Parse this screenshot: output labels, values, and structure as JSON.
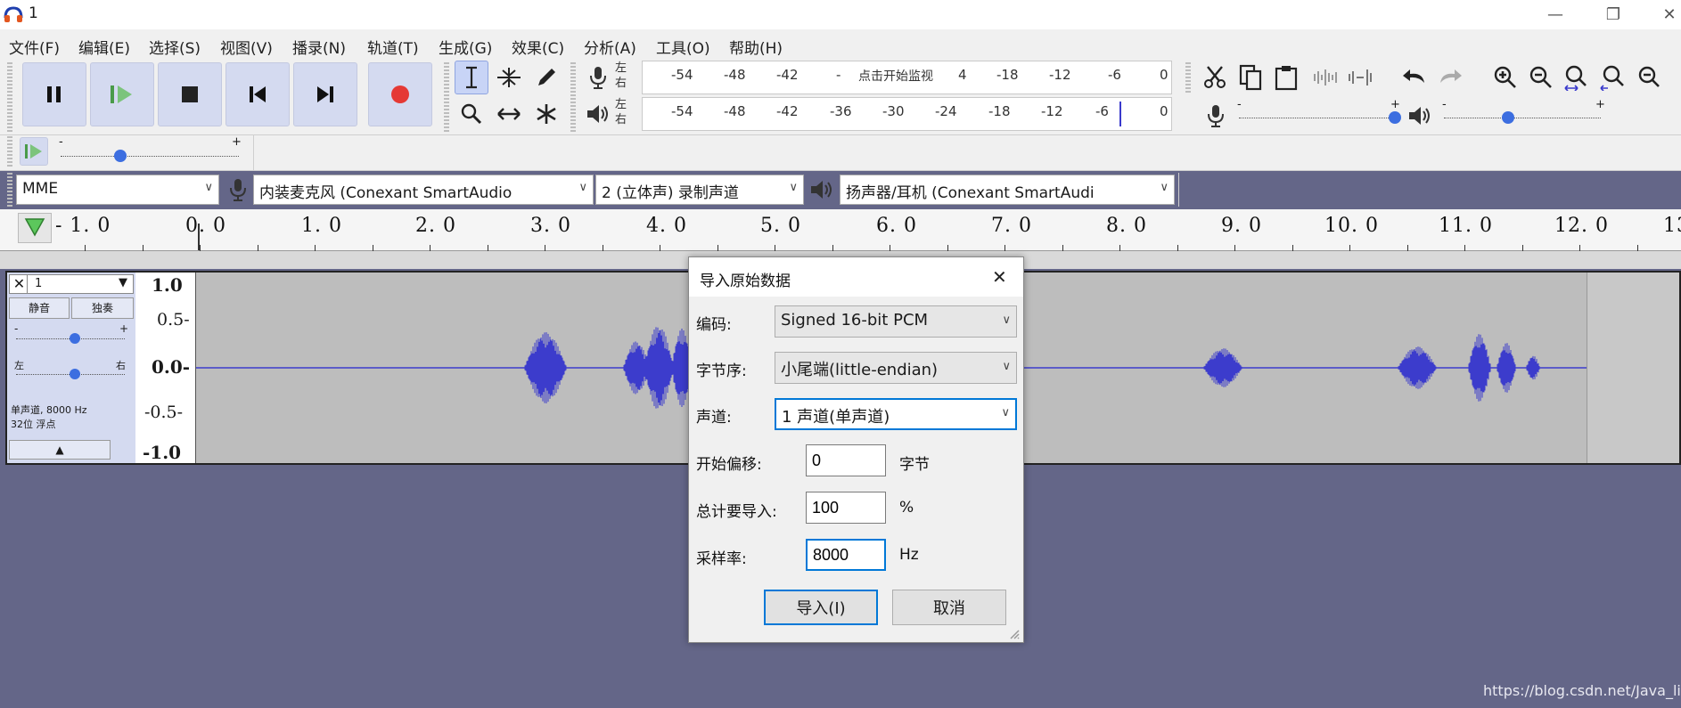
{
  "window": {
    "title": "1",
    "minimize": "—",
    "restore": "❐",
    "close": "✕"
  },
  "menu": [
    "文件(F)",
    "编辑(E)",
    "选择(S)",
    "视图(V)",
    "播录(N)",
    "轨道(T)",
    "生成(G)",
    "效果(C)",
    "分析(A)",
    "工具(O)",
    "帮助(H)"
  ],
  "transport": {
    "pause_icon": "pause-icon",
    "play_icon": "play-icon",
    "stop_icon": "stop-icon",
    "skip_start_icon": "skip-to-start-icon",
    "skip_end_icon": "skip-to-end-icon",
    "record_icon": "record-icon",
    "record_color": "#e53935",
    "accent": "#4a9b4a"
  },
  "meters": {
    "record": {
      "left": "左",
      "right": "右",
      "ticks": [
        "-54",
        "-48",
        "-42",
        "-",
        "4",
        "-18",
        "-12",
        "-6",
        "0"
      ],
      "prompt": "点击开始监视"
    },
    "playback": {
      "left": "左",
      "right": "右",
      "ticks": [
        "-54",
        "-48",
        "-42",
        "-36",
        "-30",
        "-24",
        "-18",
        "-12",
        "-6",
        "0"
      ]
    }
  },
  "mixer": {
    "minus": "-",
    "plus": "+"
  },
  "play_at_speed": {
    "minus": "-",
    "plus": "+"
  },
  "devices": {
    "host": "MME",
    "mic": "内装麦克风 (Conexant SmartAudio",
    "channels": "2 (立体声) 录制声道",
    "speaker": "扬声器/耳机 (Conexant SmartAudi"
  },
  "ruler": {
    "labels": [
      "- 1. 0",
      "0. 0",
      "1. 0",
      "2. 0",
      "3. 0",
      "4. 0",
      "5. 0",
      "6. 0",
      "7. 0",
      "8. 0",
      "9. 0",
      "10. 0",
      "11. 0",
      "12. 0",
      "13"
    ]
  },
  "track": {
    "name": "1",
    "mute": "静音",
    "solo": "独奏",
    "gain_minus": "-",
    "gain_plus": "+",
    "pan_left": "左",
    "pan_right": "右",
    "info_line1": "单声道, 8000 Hz",
    "info_line2": "32位 浮点",
    "collapse": "▲",
    "vscale": [
      "1.0",
      "0.5-",
      "0.0-",
      "-0.5-",
      "-1.0"
    ],
    "wave_color": "#3c3ccc"
  },
  "dialog": {
    "title": "导入原始数据",
    "encoding_label": "编码:",
    "encoding_value": "Signed 16-bit PCM",
    "byte_order_label": "字节序:",
    "byte_order_value": "小尾端(little-endian)",
    "channels_label": "声道:",
    "channels_value": "1 声道(单声道)",
    "offset_label": "开始偏移:",
    "offset_value": "0",
    "offset_unit": "字节",
    "amount_label": "总计要导入:",
    "amount_value": "100",
    "amount_unit": "%",
    "rate_label": "采样率:",
    "rate_value": "8000",
    "rate_unit": "Hz",
    "import_btn": "导入(I)",
    "cancel_btn": "取消",
    "close": "✕",
    "focus_color": "#0078d7"
  },
  "watermark": "https://blog.csdn.net/Java_lilin"
}
